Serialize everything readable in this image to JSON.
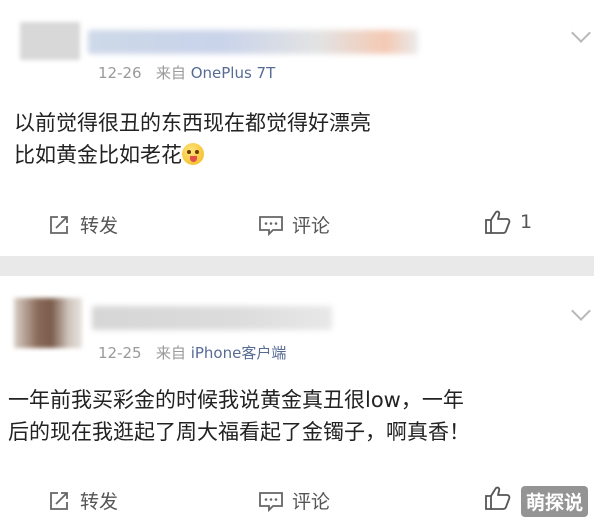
{
  "colors": {
    "source_link": "#576b95",
    "meta_text": "#9a9a9a",
    "separator": "#e9e9e9"
  },
  "posts": [
    {
      "date": "12-26",
      "source_prefix": "来自",
      "source": "OnePlus 7T",
      "lines": [
        "以前觉得很丑的东西现在都觉得好漂亮",
        "比如黄金比如老花"
      ],
      "emoji": "tongue-out-emoji",
      "actions": {
        "repost": "转发",
        "comment": "评论",
        "like_count": "1"
      }
    },
    {
      "date": "12-25",
      "source_prefix": "来自",
      "source": "iPhone客户端",
      "lines": [
        "一年前我买彩金的时候我说黄金真丑很low，一年",
        "后的现在我逛起了周大福看起了金镯子，啊真香！"
      ],
      "actions": {
        "repost": "转发",
        "comment": "评论",
        "like_count": ""
      }
    }
  ],
  "watermark": "萌探说"
}
